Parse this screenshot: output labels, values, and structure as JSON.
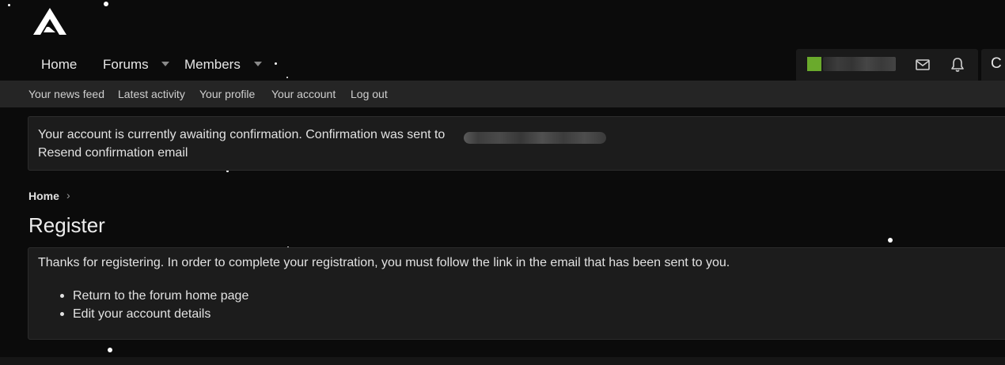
{
  "header": {
    "logo_icon": "triangle-logo-icon",
    "nav": [
      {
        "label": "Home"
      },
      {
        "label": "Forums",
        "has_dropdown": true
      },
      {
        "label": "Members",
        "has_dropdown": true
      }
    ],
    "user": {
      "avatar_color": "#6aaa2c",
      "inbox_icon": "envelope-icon",
      "alerts_icon": "bell-icon"
    },
    "search_glyph": "C"
  },
  "subnav": {
    "items": [
      {
        "label": "Your news feed"
      },
      {
        "label": "Latest activity"
      },
      {
        "label": "Your profile"
      },
      {
        "label": "Your account"
      },
      {
        "label": "Log out"
      }
    ]
  },
  "notice": {
    "message": "Your account is currently awaiting confirmation. Confirmation was sent to",
    "resend_link": "Resend confirmation email"
  },
  "breadcrumb": {
    "home": "Home",
    "separator": "›"
  },
  "page": {
    "title": "Register",
    "message": "Thanks for registering. In order to complete your registration, you must follow the link in the email that has been sent to you.",
    "links": [
      {
        "label": "Return to the forum home page"
      },
      {
        "label": "Edit your account details"
      }
    ]
  },
  "colors": {
    "background": "#0b0b0b",
    "panel": "#1c1c1c",
    "subnav": "#252525",
    "accent_avatar": "#6aaa2c"
  }
}
